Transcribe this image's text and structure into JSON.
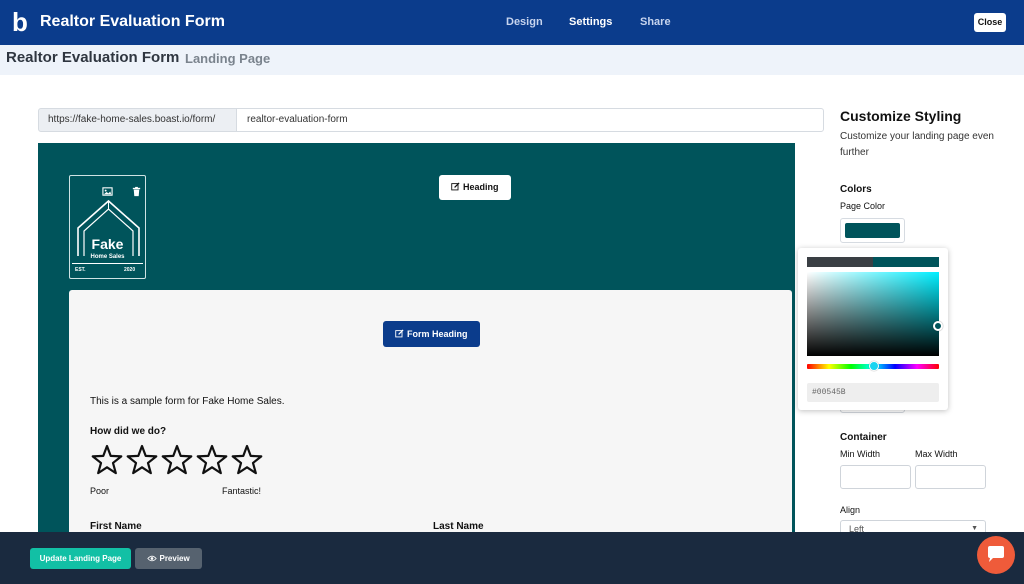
{
  "app": {
    "title": "Realtor Evaluation Form"
  },
  "nav": {
    "tabs": [
      "Design",
      "Settings",
      "Share"
    ],
    "active": "Settings",
    "close_label": "Close"
  },
  "subheader": {
    "title": "Realtor Evaluation Form",
    "page": "Landing Page"
  },
  "url": {
    "prefix": "https://fake-home-sales.boast.io/form/",
    "slug": "realtor-evaluation-form"
  },
  "preview": {
    "page_color": "#00545B",
    "logo": {
      "name": "Fake",
      "tagline": "Home Sales",
      "est_label": "EST.",
      "year": "2020"
    },
    "heading_button": "Heading",
    "form": {
      "heading_button": "Form Heading",
      "intro_text": "This is a sample form for Fake Home Sales.",
      "question": "How did we do?",
      "star_count": 5,
      "scale_low": "Poor",
      "scale_high": "Fantastic!",
      "first_name_label": "First Name",
      "last_name_label": "Last Name"
    }
  },
  "sidebar": {
    "heading": "Customize Styling",
    "description": "Customize your landing page even further",
    "colors_label": "Colors",
    "page_color_label": "Page Color",
    "container_label": "Container",
    "min_width_label": "Min Width",
    "max_width_label": "Max Width",
    "align_label": "Align",
    "align_value": "Left"
  },
  "color_picker": {
    "hex_value": "#00545B",
    "previous_color": "#3a3f44",
    "current_color": "#00545b"
  },
  "bottom_bar": {
    "update_label": "Update Landing Page",
    "preview_label": "Preview"
  },
  "colors": {
    "brand_blue": "#0b3c8c",
    "teal": "#00545b",
    "accent_green": "#12c0a5",
    "chat_orange": "#ef5b3a"
  }
}
